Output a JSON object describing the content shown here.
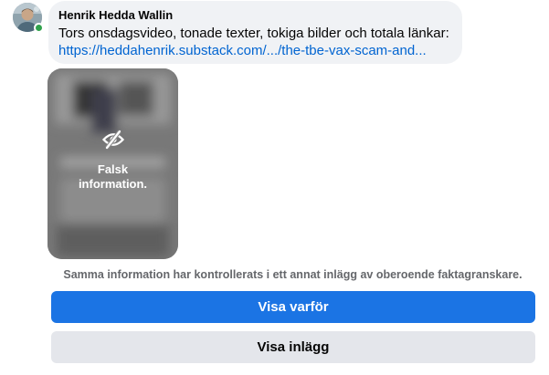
{
  "post": {
    "author": "Henrik Hedda Wallin",
    "text": "Tors onsdagsvideo, tonade texter, tokiga bilder och totala länkar:",
    "link": "https://heddahenrik.substack.com/.../the-tbe-vax-scam-and..."
  },
  "media": {
    "warning_label": "Falsk information.",
    "icon": "eye-slash-icon"
  },
  "factcheck": {
    "notice": "Samma information har kontrollerats i ett annat inlägg av oberoende faktagranskare.",
    "primary_button": "Visa varför",
    "secondary_button": "Visa inlägg"
  },
  "colors": {
    "primary": "#1b74e4",
    "link": "#0064d1",
    "online": "#31a24c",
    "bubble": "#f0f2f5",
    "secondary_button": "#e4e6eb",
    "muted_text": "#65676b"
  }
}
